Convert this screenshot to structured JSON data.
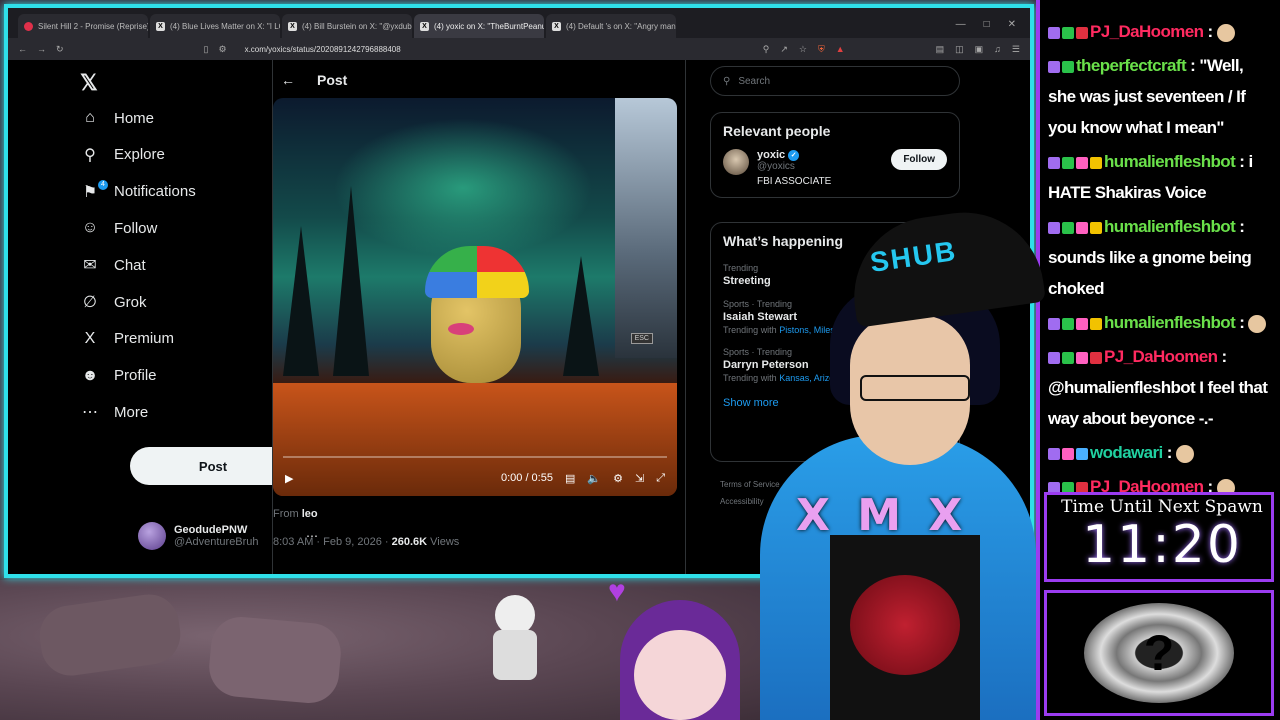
{
  "browser": {
    "tabs": [
      {
        "label": "Silent Hill 2 - Promise (Reprise)",
        "icon": "youtube-icon",
        "active": false
      },
      {
        "label": "(4) Blue Lives Matter on X: \"I LOVE…",
        "icon": "x-icon",
        "active": false
      },
      {
        "label": "(4) Bill Burstein on X: \"@yxdublo…",
        "icon": "x-icon",
        "active": false
      },
      {
        "label": "(4) yoxic on X: \"TheBurntPeanut\"",
        "icon": "x-icon",
        "active": true
      },
      {
        "label": "(4) Default 's on X: \"Angry man can…",
        "icon": "x-icon",
        "active": false
      }
    ],
    "url": "x.com/yoxics/status/2020891242796888408"
  },
  "x": {
    "nav": [
      {
        "label": "Home",
        "icon": "home-icon",
        "glyph": "⌂"
      },
      {
        "label": "Explore",
        "icon": "search-icon",
        "glyph": "⚲"
      },
      {
        "label": "Notifications",
        "icon": "bell-icon",
        "glyph": "⚑",
        "badge": "4"
      },
      {
        "label": "Follow",
        "icon": "add-person-icon",
        "glyph": "☺"
      },
      {
        "label": "Chat",
        "icon": "mail-icon",
        "glyph": "✉"
      },
      {
        "label": "Grok",
        "icon": "grok-icon",
        "glyph": "∅"
      },
      {
        "label": "Premium",
        "icon": "x-logo-icon",
        "glyph": "X"
      },
      {
        "label": "Profile",
        "icon": "person-icon",
        "glyph": "☻"
      },
      {
        "label": "More",
        "icon": "more-circle-icon",
        "glyph": "⋯"
      }
    ],
    "post_button": "Post",
    "account": {
      "name": "GeodudePNW",
      "handle": "@AdventureBruh"
    },
    "post": {
      "header": "Post",
      "video_time": "0:00 / 0:55",
      "esc_label": "ESC",
      "from_prefix": "From ",
      "from_name": "leo",
      "timestamp": "8:03 AM · Feb 9, 2026 · ",
      "views_count": "260.6K",
      "views_label": " Views"
    },
    "search_placeholder": "Search",
    "relevant_people": {
      "title": "Relevant people",
      "name": "yoxic",
      "handle": "@yoxics",
      "bio": "FBI ASSOCIATE",
      "follow_label": "Follow"
    },
    "whats_happening": {
      "title": "What’s happening",
      "trends": [
        {
          "category": "Trending",
          "name": "Streeting",
          "with_prefix": "",
          "with": ""
        },
        {
          "category": "Sports · Trending",
          "name": "Isaiah Stewart",
          "with_prefix": "Trending with ",
          "with": "Pistons, Miles B"
        },
        {
          "category": "Sports · Trending",
          "name": "Darryn Peterson",
          "with_prefix": "Trending with ",
          "with": "Kansas, Arizona"
        }
      ],
      "show_more": "Show more"
    },
    "footer": [
      "Terms of Service",
      "Accessibility"
    ]
  },
  "chat": {
    "messages": [
      {
        "user": "PJ_DaHoomen",
        "sep": " : ",
        "text": "",
        "color": "#ff2a60"
      },
      {
        "user": "theperfectcraft",
        "sep": " : ",
        "text": "\"Well, she was just seventeen / If you know what I mean\"",
        "color": "#6ae04a"
      },
      {
        "user": "humalienfleshbot",
        "sep": " : ",
        "text": "i HATE Shakiras Voice",
        "color": "#6ae04a"
      },
      {
        "user": "humalienfleshbot",
        "sep": " : ",
        "text": "sounds like a gnome being choked",
        "color": "#6ae04a"
      },
      {
        "user": "humalienfleshbot",
        "sep": " : ",
        "text": "",
        "color": "#6ae04a"
      },
      {
        "user": "PJ_DaHoomen",
        "sep": " : ",
        "text": "@humalienfleshbot I feel that way about beyonce -.-",
        "color": "#ff2a60"
      },
      {
        "user": "wodawari",
        "sep": " : ",
        "text": "",
        "color": "#20d0a0"
      },
      {
        "user": "PJ_DaHoomen",
        "sep": " : ",
        "text": "",
        "color": "#ff2a60"
      }
    ]
  },
  "timer": {
    "label": "Time Until Next Spawn",
    "value": "11:20"
  },
  "overlay": {
    "hoodie_text": "X M X",
    "cap_text": "SHUB"
  }
}
